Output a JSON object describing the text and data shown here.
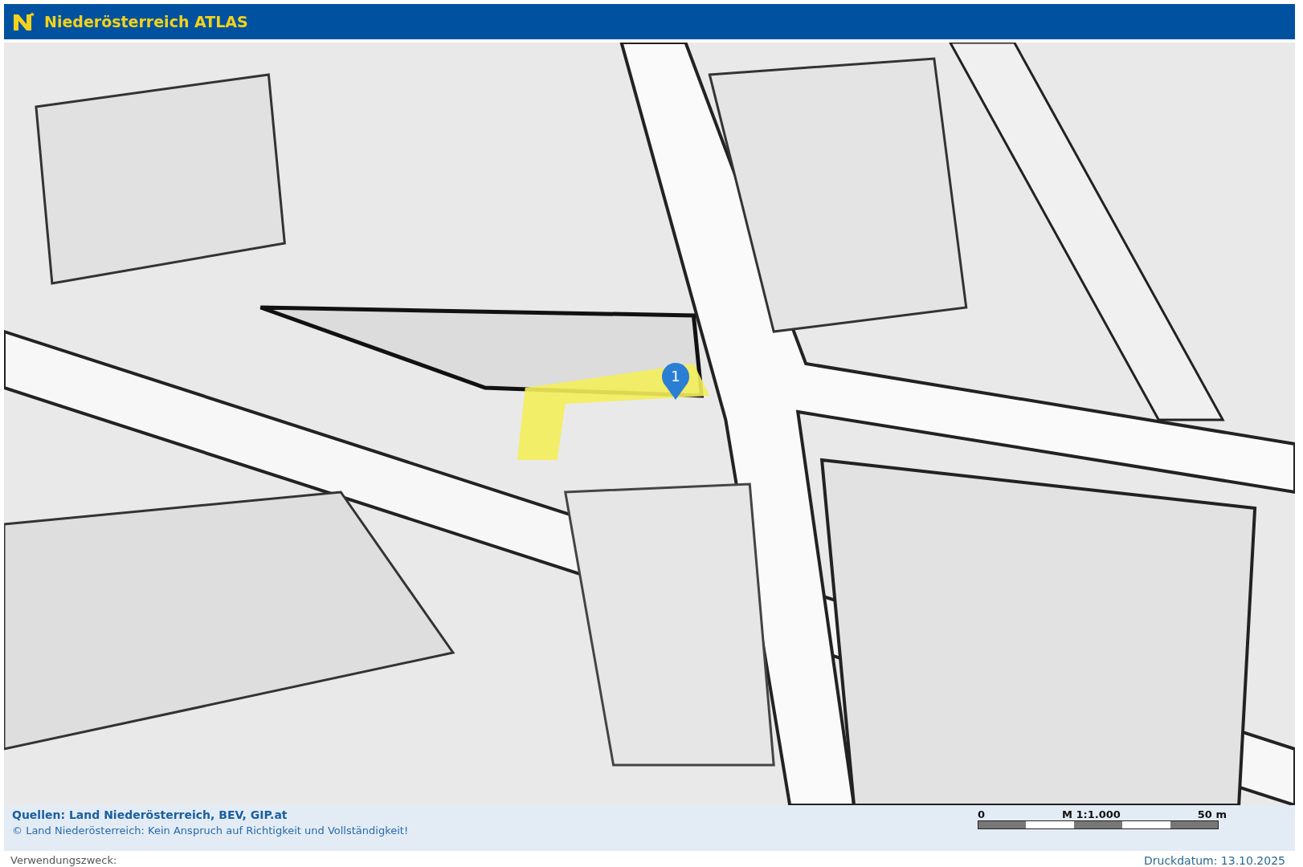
{
  "header": {
    "title": "Niederösterreich ATLAS"
  },
  "map": {
    "marker": {
      "label": "1"
    }
  },
  "footer": {
    "sources": "Quellen: Land Niederösterreich, BEV, GIP.at",
    "copyright": "© Land Niederösterreich: Kein Anspruch auf Richtigkeit und Vollständigkeit!",
    "scale": {
      "start": "0",
      "ratio": "M 1:1.000",
      "end": "50 m"
    }
  },
  "bottom": {
    "purpose": "Verwendungszweck:",
    "print_date": "Druckdatum: 13.10.2025"
  }
}
